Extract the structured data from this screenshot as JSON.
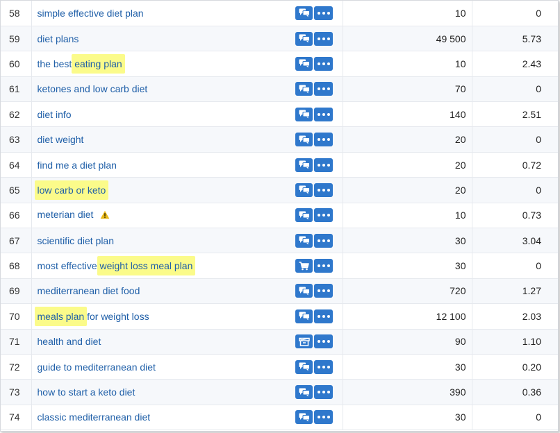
{
  "rows": [
    {
      "num": "58",
      "parts": [
        {
          "t": "simple effective diet plan",
          "hl": false
        }
      ],
      "icon": "chat-bubbles-icon",
      "warning": false,
      "volume": "10",
      "cpc": "0"
    },
    {
      "num": "59",
      "parts": [
        {
          "t": "diet plans",
          "hl": false
        }
      ],
      "icon": "chat-bubbles-icon",
      "warning": false,
      "volume": "49 500",
      "cpc": "5.73"
    },
    {
      "num": "60",
      "parts": [
        {
          "t": "the best ",
          "hl": false
        },
        {
          "t": "eating plan",
          "hl": true
        }
      ],
      "icon": "chat-bubbles-icon",
      "warning": false,
      "volume": "10",
      "cpc": "2.43"
    },
    {
      "num": "61",
      "parts": [
        {
          "t": "ketones and low carb diet",
          "hl": false
        }
      ],
      "icon": "chat-bubbles-icon",
      "warning": false,
      "volume": "70",
      "cpc": "0"
    },
    {
      "num": "62",
      "parts": [
        {
          "t": "diet info",
          "hl": false
        }
      ],
      "icon": "chat-bubbles-icon",
      "warning": false,
      "volume": "140",
      "cpc": "2.51"
    },
    {
      "num": "63",
      "parts": [
        {
          "t": "diet weight",
          "hl": false
        }
      ],
      "icon": "chat-bubbles-icon",
      "warning": false,
      "volume": "20",
      "cpc": "0"
    },
    {
      "num": "64",
      "parts": [
        {
          "t": "find me a diet plan",
          "hl": false
        }
      ],
      "icon": "chat-bubbles-icon",
      "warning": false,
      "volume": "20",
      "cpc": "0.72"
    },
    {
      "num": "65",
      "parts": [
        {
          "t": "low carb or keto",
          "hl": true
        }
      ],
      "icon": "chat-bubbles-icon",
      "warning": false,
      "volume": "20",
      "cpc": "0"
    },
    {
      "num": "66",
      "parts": [
        {
          "t": "meterian diet",
          "hl": false
        }
      ],
      "icon": "chat-bubbles-icon",
      "warning": true,
      "volume": "10",
      "cpc": "0.73"
    },
    {
      "num": "67",
      "parts": [
        {
          "t": "scientific diet plan",
          "hl": false
        }
      ],
      "icon": "chat-bubbles-icon",
      "warning": false,
      "volume": "30",
      "cpc": "3.04"
    },
    {
      "num": "68",
      "parts": [
        {
          "t": "most effective ",
          "hl": false
        },
        {
          "t": "weight loss meal plan",
          "hl": true
        }
      ],
      "icon": "shopping-cart-icon",
      "warning": false,
      "volume": "30",
      "cpc": "0"
    },
    {
      "num": "69",
      "parts": [
        {
          "t": "mediterranean diet food",
          "hl": false
        }
      ],
      "icon": "chat-bubbles-icon",
      "warning": false,
      "volume": "720",
      "cpc": "1.27"
    },
    {
      "num": "70",
      "parts": [
        {
          "t": "meals plan",
          "hl": true
        },
        {
          "t": " for weight loss",
          "hl": false
        }
      ],
      "icon": "chat-bubbles-icon",
      "warning": false,
      "volume": "12 100",
      "cpc": "2.03"
    },
    {
      "num": "71",
      "parts": [
        {
          "t": "health and diet",
          "hl": false
        }
      ],
      "icon": "open-box-icon",
      "warning": false,
      "volume": "90",
      "cpc": "1.10"
    },
    {
      "num": "72",
      "parts": [
        {
          "t": "guide to mediterranean diet",
          "hl": false
        }
      ],
      "icon": "chat-bubbles-icon",
      "warning": false,
      "volume": "30",
      "cpc": "0.20"
    },
    {
      "num": "73",
      "parts": [
        {
          "t": "how to start a keto diet",
          "hl": false
        }
      ],
      "icon": "chat-bubbles-icon",
      "warning": false,
      "volume": "390",
      "cpc": "0.36"
    },
    {
      "num": "74",
      "parts": [
        {
          "t": "classic mediterranean diet",
          "hl": false
        }
      ],
      "icon": "chat-bubbles-icon",
      "warning": false,
      "volume": "30",
      "cpc": "0"
    }
  ],
  "colors": {
    "link": "#1f5fa8",
    "highlight": "#fbfb8a",
    "button": "#2f78cc",
    "warning": "#e8b818"
  }
}
